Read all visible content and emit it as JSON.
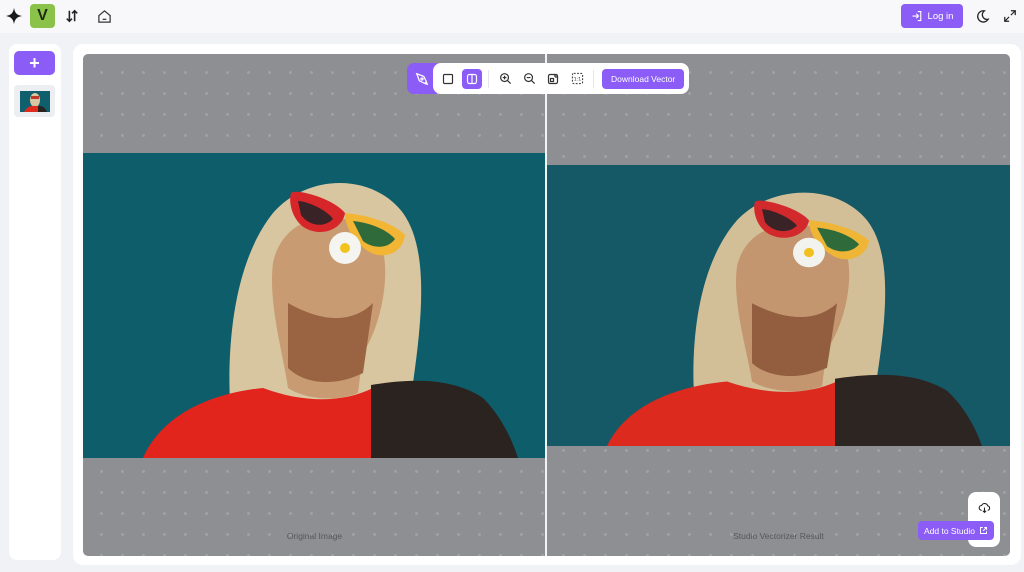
{
  "topbar": {
    "logo_letter": "V",
    "login_label": "Log in",
    "icons": [
      "sparkle-icon",
      "sort-arrows-icon",
      "home-icon",
      "login-icon",
      "moon-icon",
      "expand-icon"
    ]
  },
  "sidebar": {
    "add_icon": "+",
    "thumbnails": [
      {
        "alt": "girl with sunglasses and daisy"
      }
    ]
  },
  "toolbar": {
    "tools": [
      "pen-tool",
      "single-view",
      "split-view",
      "zoom-in",
      "zoom-out",
      "fit-screen",
      "actual-size"
    ],
    "active_tool": "split-view",
    "download_label": "Download Vector"
  },
  "panes": {
    "left_label": "Original Image",
    "right_label": "Studio Vectorizer Result"
  },
  "actions": {
    "add_to_studio_label": "Add to Studio"
  },
  "colors": {
    "accent": "#8b5cf6",
    "logo_bg": "#8bc34a",
    "canvas_bg": "#8e8f93",
    "sky": "#0e5c69"
  }
}
